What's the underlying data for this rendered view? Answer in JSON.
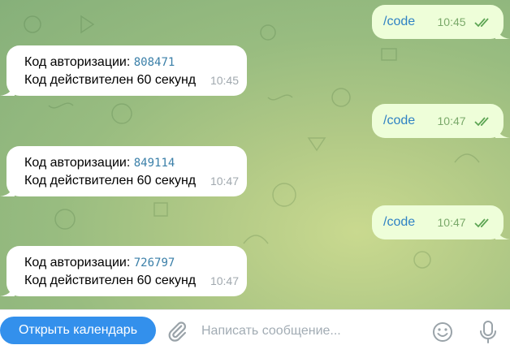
{
  "messages": [
    {
      "type": "out",
      "text": "/code",
      "time": "10:45"
    },
    {
      "type": "in",
      "label": "Код авторизации: ",
      "code": "808471",
      "line2": "Код действителен 60 секунд",
      "time": "10:45"
    },
    {
      "type": "out",
      "text": "/code",
      "time": "10:47"
    },
    {
      "type": "in",
      "label": "Код авторизации: ",
      "code": "849114",
      "line2": "Код действителен 60 секунд",
      "time": "10:47"
    },
    {
      "type": "out",
      "text": "/code",
      "time": "10:47"
    },
    {
      "type": "in",
      "label": "Код авторизации: ",
      "code": "726797",
      "line2": "Код действителен 60 секунд",
      "time": "10:47"
    }
  ],
  "composer": {
    "button_label": "Открыть календарь",
    "placeholder": "Написать сообщение..."
  },
  "icons": {
    "attach": "paperclip-icon",
    "emoji": "smile-icon",
    "mic": "microphone-icon",
    "read": "double-check-icon"
  },
  "colors": {
    "accent": "#3390ec",
    "outgoing_bubble": "#eefed9",
    "incoming_bubble": "#ffffff",
    "code_text": "#3a7fa8"
  }
}
